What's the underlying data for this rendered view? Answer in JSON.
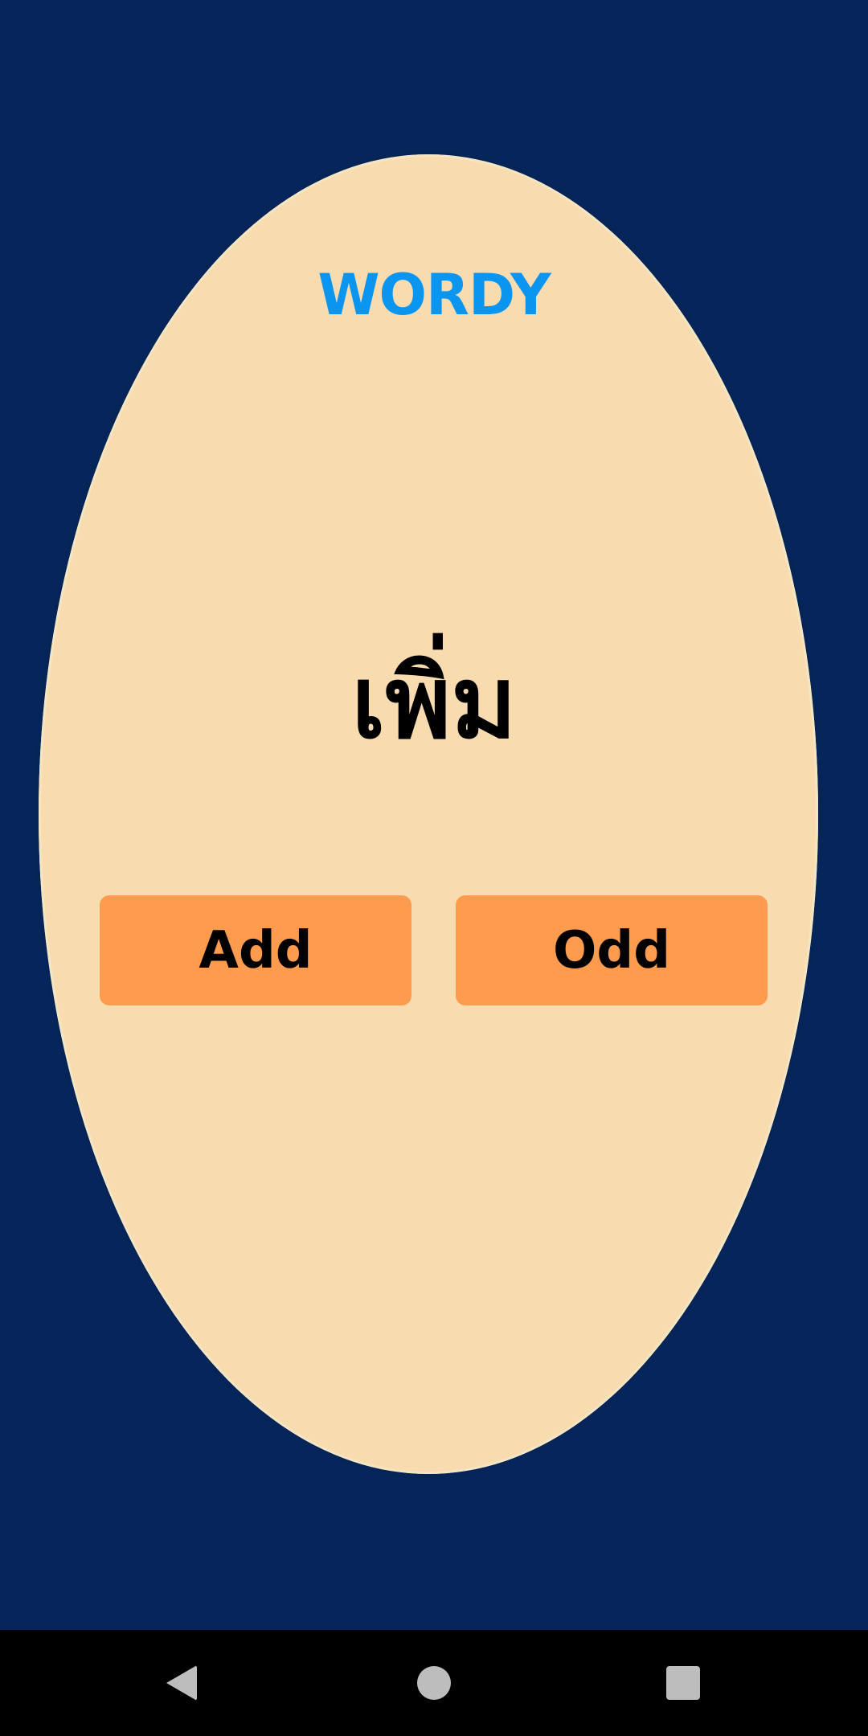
{
  "app": {
    "title": "WORDY",
    "title_color": "#0a95f0",
    "background_color": "#06265b",
    "card_color": "#f8dcb0"
  },
  "question": {
    "word": "เพิ่ม"
  },
  "choices": {
    "color": "#ff9b4e",
    "options": [
      {
        "label": "Add"
      },
      {
        "label": "Odd"
      }
    ]
  },
  "nav_bar": {
    "icons": [
      "back-icon",
      "home-icon",
      "recents-icon"
    ]
  }
}
